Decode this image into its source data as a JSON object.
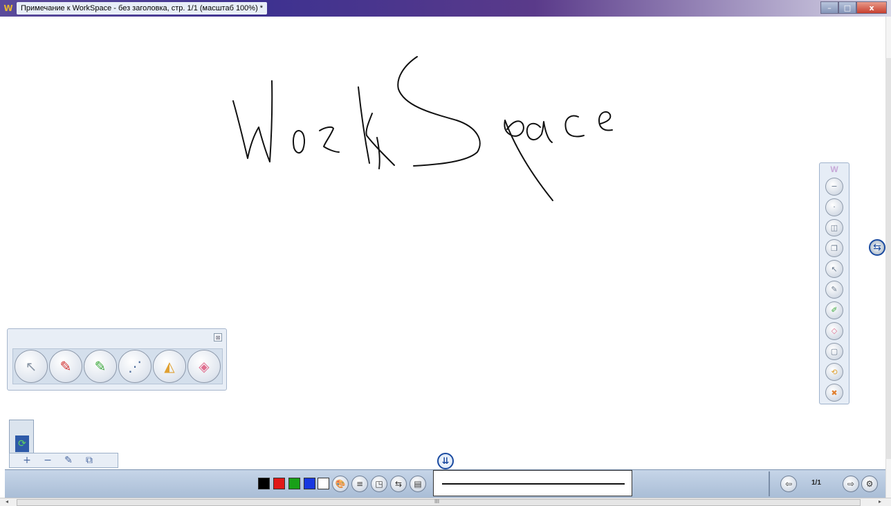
{
  "window": {
    "app_icon": "W",
    "title": "Примечание к WorkSpace - без заголовка, стр. 1/1 (масштаб 100%) *",
    "minimize_glyph": "–",
    "maximize_glyph": "□",
    "close_glyph": "x"
  },
  "canvas": {
    "ink_color": "#111111"
  },
  "right_toolbar": {
    "logo": "W",
    "buttons": [
      {
        "name": "circle-minus-icon",
        "glyph": "−"
      },
      {
        "name": "circle-dot-icon",
        "glyph": "·"
      },
      {
        "name": "mouse-icon",
        "glyph": "◫"
      },
      {
        "name": "copy-pages-icon",
        "glyph": "❐"
      },
      {
        "name": "select-arrow-icon",
        "glyph": "↖"
      },
      {
        "name": "pen-icon",
        "glyph": "✎"
      },
      {
        "name": "highlighter-icon",
        "glyph": "✐"
      },
      {
        "name": "eraser-icon",
        "glyph": "◇"
      },
      {
        "name": "blank-page-icon",
        "glyph": "▢"
      },
      {
        "name": "capture-icon",
        "glyph": "⟲"
      },
      {
        "name": "exit-icon",
        "glyph": "✖"
      }
    ]
  },
  "left_toolbar": {
    "close_glyph": "⊠",
    "tools": [
      {
        "name": "select-tool-icon",
        "glyph": "↖",
        "color": "#8a96a6"
      },
      {
        "name": "pen-tool-icon",
        "glyph": "✎",
        "color": "#d03030"
      },
      {
        "name": "highlighter-tool-icon",
        "glyph": "✎",
        "color": "#3aa83a"
      },
      {
        "name": "creative-pen-icon",
        "glyph": "⋰",
        "color": "#4a6a9a"
      },
      {
        "name": "shapes-tool-icon",
        "glyph": "◭",
        "color": "#e0a030"
      },
      {
        "name": "eraser-tool-icon",
        "glyph": "◈",
        "color": "#e07090"
      }
    ]
  },
  "page_controls": {
    "thumb_glyph": "⟳",
    "add_glyph": "+",
    "remove_glyph": "−",
    "edit_glyph": "✎",
    "duplicate_glyph": "⧉"
  },
  "center_toggle_glyph": "⇊",
  "side_toggle_glyph": "⇆",
  "bottom_bar": {
    "colors": [
      "#000000",
      "#e01818",
      "#18a018",
      "#1838e0",
      "#ffffff"
    ],
    "buttons": [
      {
        "name": "color-palette-icon",
        "glyph": "🎨"
      },
      {
        "name": "line-width-icon",
        "glyph": "≡"
      },
      {
        "name": "transparency-icon",
        "glyph": "◳"
      },
      {
        "name": "line-style-icon",
        "glyph": "⇆"
      },
      {
        "name": "line-pattern-icon",
        "glyph": "▤"
      }
    ],
    "prev_glyph": "⇦",
    "page_indicator": "1/1",
    "next_glyph": "⇨",
    "tools_glyph": "⚙"
  },
  "scrollbar": {
    "left_arrow": "◂",
    "right_arrow": "▸",
    "grip": "III"
  }
}
